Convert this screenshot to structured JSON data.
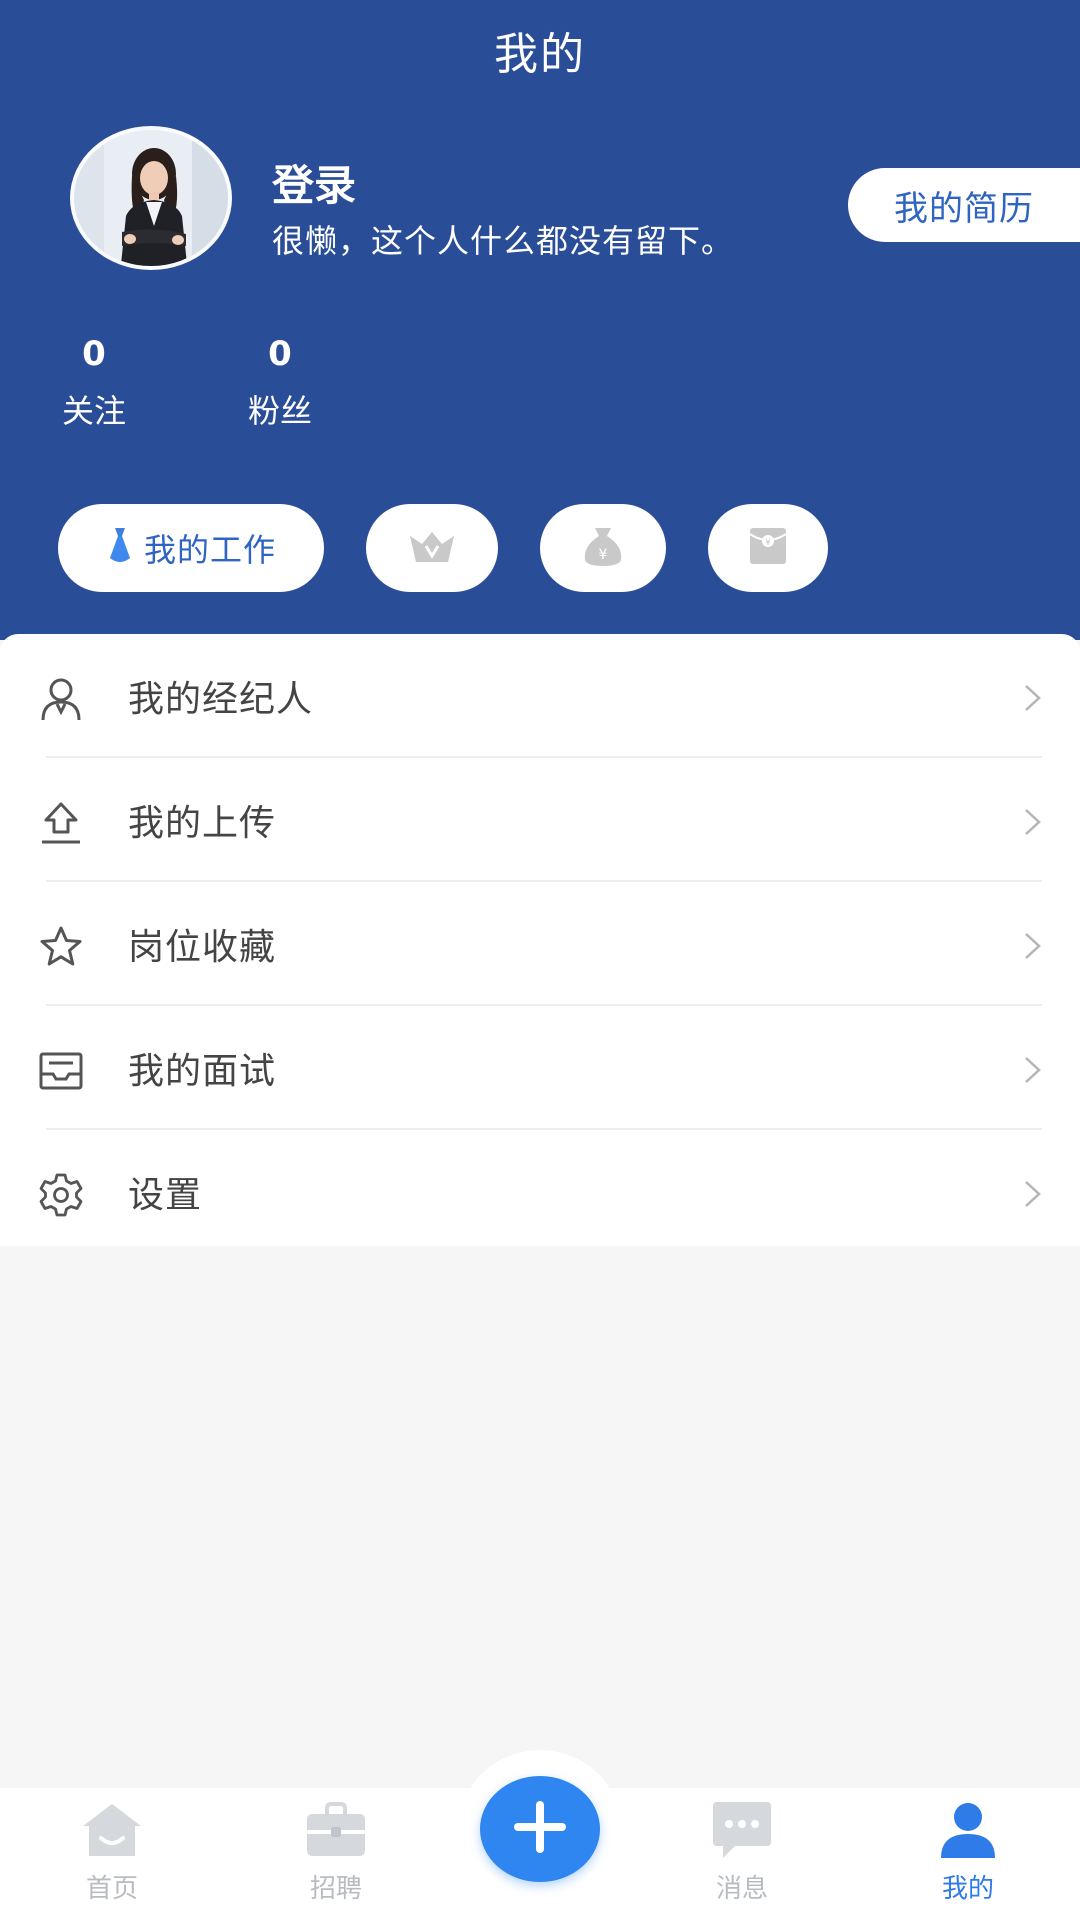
{
  "header": {
    "title": "我的",
    "login_label": "登录",
    "bio": "很懒，这个人什么都没有留下。",
    "resume_button": "我的简历"
  },
  "stats": [
    {
      "value": "0",
      "label": "关注"
    },
    {
      "value": "0",
      "label": "粉丝"
    }
  ],
  "quick_actions": {
    "work_label": "我的工作",
    "icons": [
      "tie-icon",
      "crown-vip-icon",
      "money-bag-icon",
      "red-envelope-icon"
    ]
  },
  "menu": {
    "items": [
      {
        "label": "我的经纪人",
        "icon": "agent-person-icon"
      },
      {
        "label": "我的上传",
        "icon": "upload-icon"
      },
      {
        "label": "岗位收藏",
        "icon": "star-icon"
      },
      {
        "label": "我的面试",
        "icon": "inbox-icon"
      },
      {
        "label": "设置",
        "icon": "gear-icon"
      }
    ]
  },
  "tabbar": {
    "items": [
      {
        "label": "首页",
        "icon": "home-icon"
      },
      {
        "label": "招聘",
        "icon": "briefcase-icon"
      },
      {
        "label": "",
        "icon": "plus-icon"
      },
      {
        "label": "消息",
        "icon": "message-icon"
      },
      {
        "label": "我的",
        "icon": "user-icon",
        "active": true
      }
    ]
  },
  "colors": {
    "header_bg": "#2a4d98",
    "accent": "#2f64c2",
    "tab_active": "#2f7be8",
    "tab_inactive": "#b8bcc2"
  }
}
